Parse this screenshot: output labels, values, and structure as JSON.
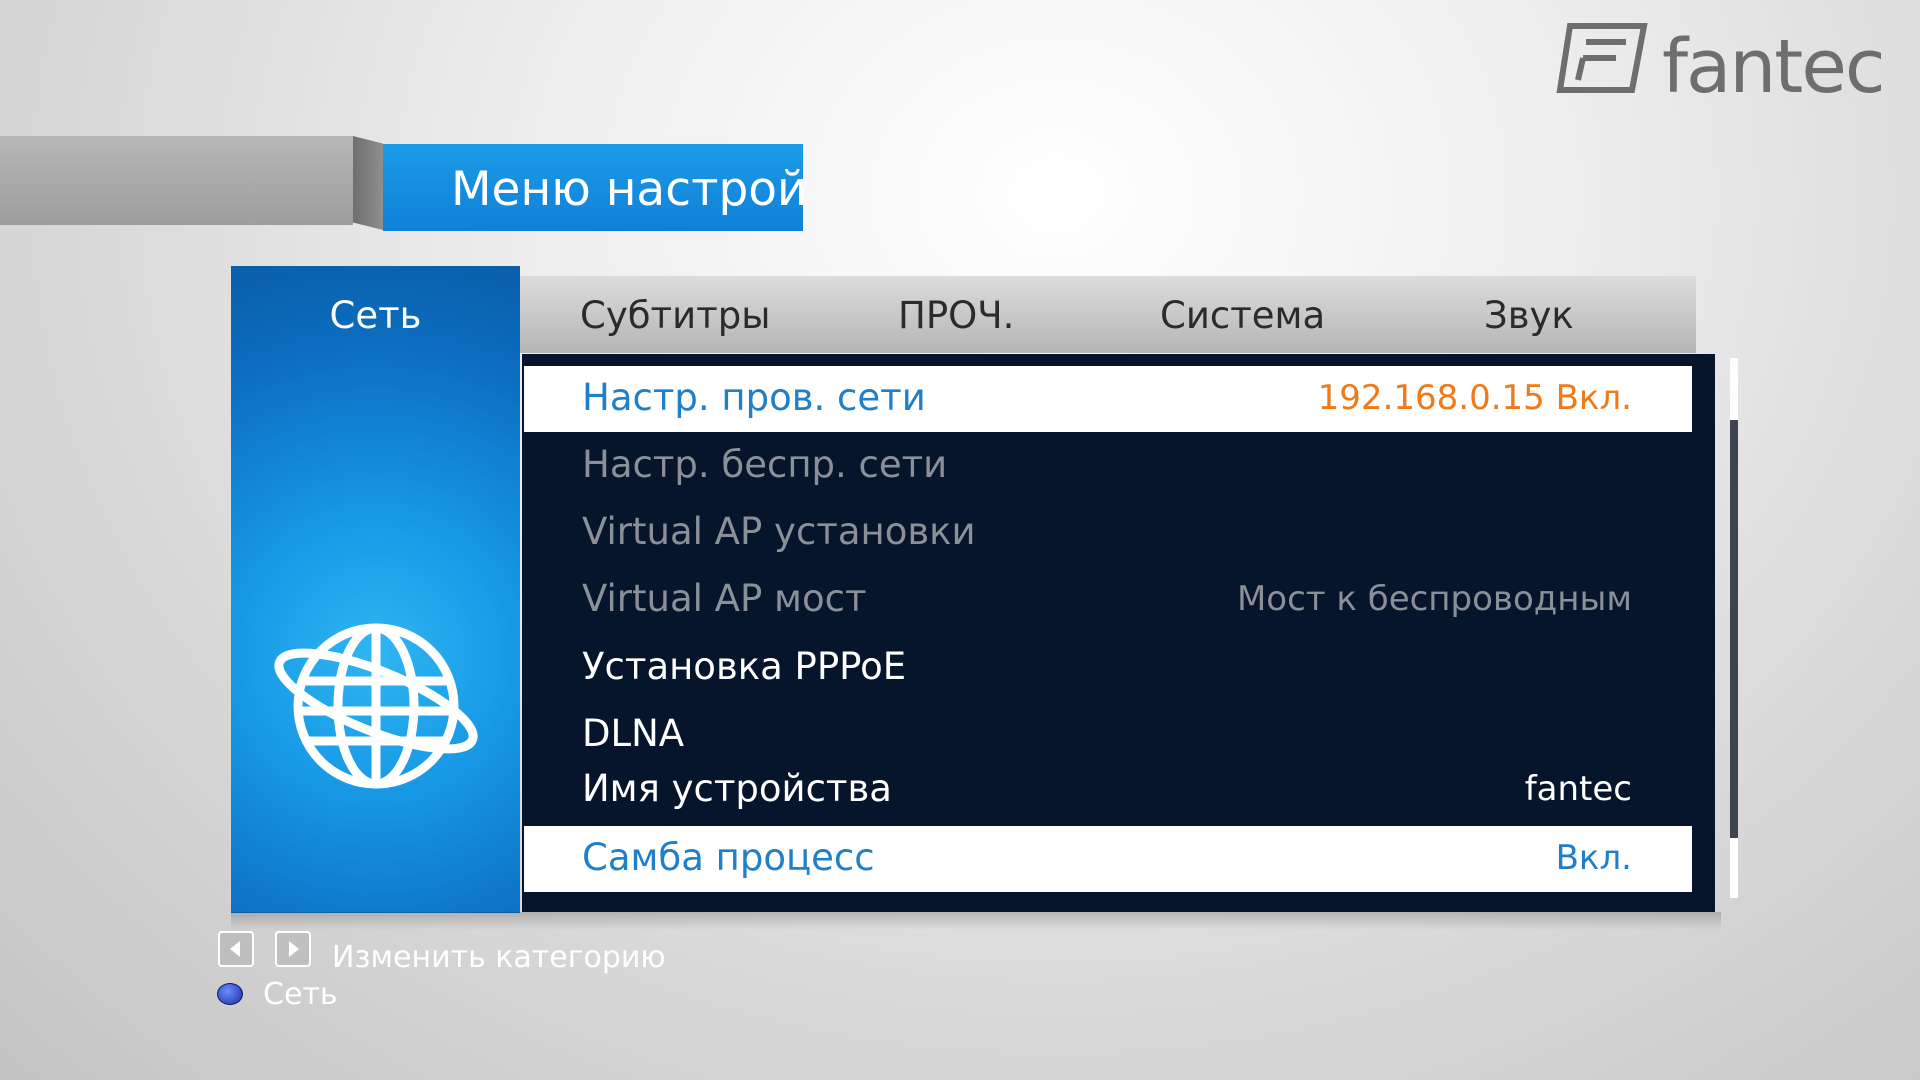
{
  "brand": {
    "logo_text": "fantec"
  },
  "title": "Меню настройки",
  "sidebar": {
    "active_category": "Сеть",
    "icon": "globe-icon"
  },
  "tabs": [
    {
      "label": "Субтитры"
    },
    {
      "label": "ПРОЧ."
    },
    {
      "label": "Система"
    },
    {
      "label": "Звук"
    }
  ],
  "menu": [
    {
      "label": "Настр. пров. сети",
      "value": "192.168.0.15 Вкл.",
      "selected": true,
      "state": "highlight"
    },
    {
      "label": "Настр. беспр. сети",
      "value": "",
      "state": "disabled"
    },
    {
      "label": "Virtual AP установки",
      "value": "",
      "state": "disabled"
    },
    {
      "label": "Virtual AP мост",
      "value": "Мост к беспроводным",
      "state": "disabled"
    },
    {
      "label": "Установка PPPoE",
      "value": "",
      "state": "normal"
    },
    {
      "label": "DLNA",
      "value": "",
      "state": "normal"
    },
    {
      "label": "Имя устройства",
      "value": "fantec",
      "state": "normal"
    },
    {
      "label": "Самба процесс",
      "value": "Вкл.",
      "selected": true,
      "state": "highlight"
    }
  ],
  "footer": {
    "change_category": "Изменить категорию",
    "current": "Сеть"
  },
  "colors": {
    "accent_blue": "#1a8fe0",
    "selected_text": "#1f7fc8",
    "value_orange": "#ee7a1a",
    "disabled_text": "#8a8f98",
    "content_bg": "#06152b"
  }
}
